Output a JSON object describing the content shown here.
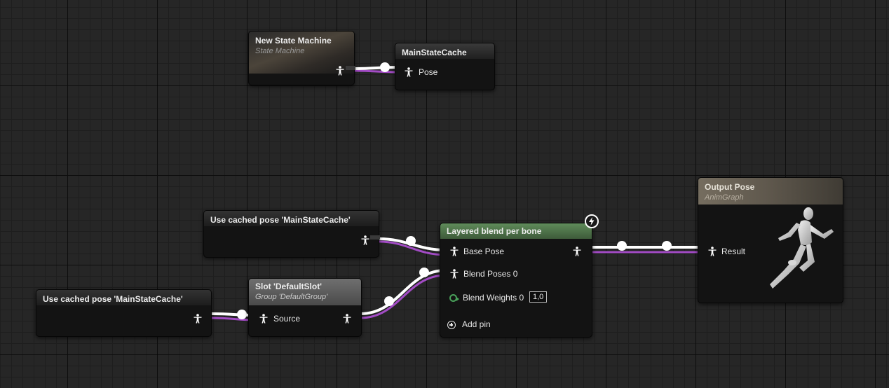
{
  "graph": {
    "nodes": {
      "state_machine": {
        "title": "New State Machine",
        "subtitle": "State Machine"
      },
      "cache": {
        "title": "MainStateCache",
        "pin_pose": "Pose"
      },
      "cached_pose_top": {
        "title": "Use cached pose 'MainStateCache'"
      },
      "cached_pose_bottom": {
        "title": "Use cached pose 'MainStateCache'"
      },
      "slot": {
        "title": "Slot 'DefaultSlot'",
        "subtitle": "Group 'DefaultGroup'",
        "pin_source": "Source"
      },
      "layered_blend": {
        "title": "Layered blend per bone",
        "pin_base_pose": "Base Pose",
        "pin_blend_poses": "Blend Poses 0",
        "pin_blend_weights": "Blend Weights 0",
        "blend_weights_value": "1,0",
        "add_pin": "Add pin"
      },
      "output_pose": {
        "title": "Output Pose",
        "subtitle": "AnimGraph",
        "pin_result": "Result"
      }
    },
    "colors": {
      "wire_white": "#ffffff",
      "wire_purple": "#a24bc4",
      "blend_header": "#4f7a4b",
      "weights_pin": "#49a05a"
    },
    "icons": {
      "pose_pin": "person-figure-icon",
      "fast_path": "lightning-icon",
      "add_pin": "plus-circle-icon",
      "preview": "mannequin-running-icon"
    }
  }
}
